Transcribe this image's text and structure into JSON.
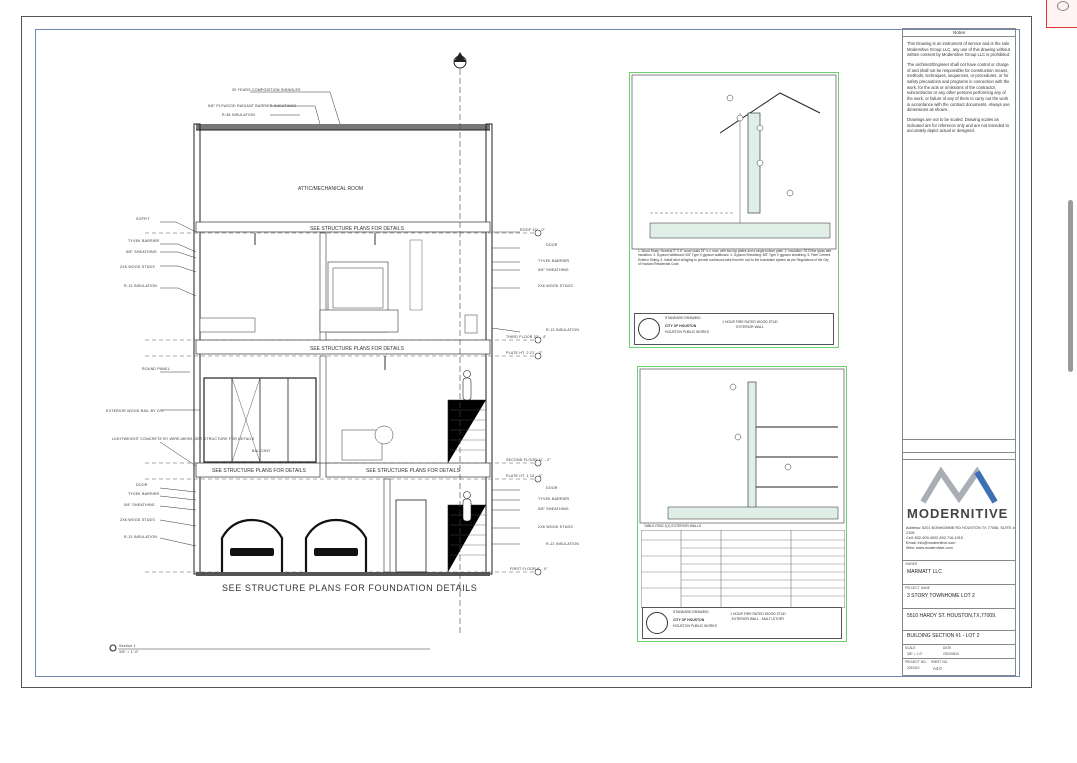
{
  "section": {
    "roof_label": "30 YEARS COMPOSITION SHINGLES",
    "radiant_label": "5/8\" PLYWOOD RADIANT BARRIER SHEATHING",
    "r38_label": "R-38 INSULATION",
    "attic_room": "ATTIC/MECHANICAL ROOM",
    "see_structure_top": "SEE STRUCTURE PLANS FOR DETAILS",
    "see_structure_mid": "SEE STRUCTURE PLANS FOR DETAILS",
    "see_structure_left": "SEE STRUCTURE PLANS FOR DETAILS",
    "see_structure_right": "SEE STRUCTURE PLANS FOR DETAILS",
    "foundation_note": "SEE STRUCTURE PLANS FOR FOUNDATION DETAILS",
    "balcony": "BALCONY",
    "left_labels": [
      "SOFFIT",
      "TYVEK BARRIER",
      "5/8\" SHEATHING",
      "2X6 WOOD STUDS",
      "R-13 INSULATION",
      "ROUND PANEL",
      "EXTERIOR WOOD RAIL BY G.C.",
      "LIGHTWEIGHT CONCRETE BY WIRE-MESH, SEE STRUCTURE FOR DETAILS",
      "DOOR",
      "TYVEK BARRIER",
      "5/8\" SHEATHING",
      "2X6 WOOD STUDS",
      "R-13 INSULATION"
    ],
    "right_labels": [
      "ROOF 33' - 0\"",
      "DOOR",
      "TYVEK BARRIER",
      "5/8\" SHEATHING",
      "2X6 WOOD STUDS",
      "R-13 INSULATION",
      "THIRD FLOOR 22' - 4\"",
      "PLATE HT. 2 21' - 2\"",
      "SECOND FLOOR 11' - 2\"",
      "PLATE HT. 1 10' - 0\"",
      "DOOR",
      "TYVEK BARRIER",
      "5/8\" SHEATHING",
      "2X6 WOOD STUDS",
      "R-13 INSULATION",
      "FIRST FLOOR 0' - 0\""
    ],
    "section_tag": "Section 1",
    "section_scale": "3/8\" = 1'-0\""
  },
  "detail_top": {
    "notes": "1. Wood Study: Nominal 2\" X 6\" wood studs 24\" o.c. max, with two top plates and a single bottom plate. 2. Insulation: R13 fiber glass batt insulation. 3. Gypsum Wallboard: 5/8\" Type X gypsum wallboard. 4. Gypsum Sheathing: 5/8\" Type X gypsum sheathing. 5. Fiber Cement Exterior Siding. 6. Install wind shingling to provide continuous tabs from the roof to the foundation system as per Regulations of the City of Houston Residential Code.",
    "footer_standard": "STANDARD DRAWING",
    "footer_title": "1 HOUR FIRE RATED WOOD STUD EXTERIOR WALL",
    "footer_city": "CITY OF HOUSTON",
    "footer_dept": "HOUSTON PUBLIC WORKS"
  },
  "detail_bottom": {
    "table_title": "TABLE R302.1(1) EXTERIOR WALLS",
    "footer_standard": "STANDARD DRAWING",
    "footer_title": "1 HOUR FIRE RATED WOOD STUD EXTERIOR WALL - MULTI-STORY",
    "footer_city": "CITY OF HOUSTON",
    "footer_dept": "HOUSTON PUBLIC WORKS"
  },
  "titleblock": {
    "notes_header": "Notes",
    "note1": "This Drawing is an instrument of service and is the sole Modernitive Group LLC, any use of this drawing without written consent by Modernitive Group LLC is prohibited.",
    "note2": "The architect/Engineer shall not have control or charge of and shall not be responsible for construction means, methods, techniques, sequences, or procedures, or for safety precautions and programs in connection with the work, for the acts or omissions of the contractor, subcontractor or any other persons performing any of the work, or failure of any of them to carry out the work in accordance with the contract documents. Always use dimensions as shown.",
    "note3": "Drawings are not to be scaled. Drawing scales as indicated are for reference only and are not intended to accurately depict actual or designed.",
    "brand": "MODERNITIVE",
    "address": "Address: 5201 BONHOMME RD HOUSTON TX 77056, SUITE # 2106",
    "phone": "Cell: 832-909-4002 832-716-1915",
    "email": "Email: info@modernitive.com",
    "web": "Web: www.modernitive.com",
    "owner_label": "OWNER",
    "owner": "MARMATT LLC",
    "project_label": "PROJECT NAME",
    "project": "3 STORY TOWNHOME LOT 2",
    "address_label": "ADDRESS",
    "site_address": "5510 HARDY ST. HOUSTON,TX,77009.",
    "sheet_label": "SHEET TITLE",
    "sheet": "BUILDING SECTION #1 - LOT 2",
    "scale_label": "SCALE",
    "scale": "3/8\" = 1'-0\"",
    "date_label": "DATE",
    "date": "2022/08/10",
    "project_no_label": "PROJECT NO.",
    "project_no": "2022010",
    "sheet_no_label": "SHEET NO.",
    "sheet_no": "A4.0"
  }
}
